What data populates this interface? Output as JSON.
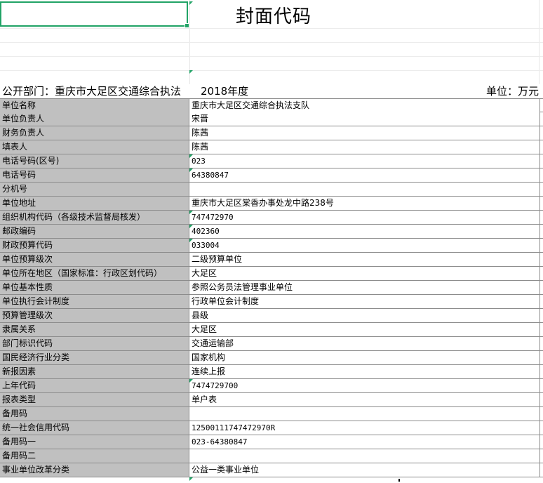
{
  "sheet": {
    "title": "封面代码",
    "department_line": "公开部门：重庆市大足区交通综合执法",
    "year": "2018年度",
    "unit": "单位：万元"
  },
  "rows": [
    {
      "label": "单位名称",
      "value": "重庆市大足区交通综合执法支队",
      "mono": false,
      "marked": false
    },
    {
      "label": "单位负责人",
      "value": "宋晋",
      "mono": false,
      "marked": false
    },
    {
      "label": "财务负责人",
      "value": "陈茜",
      "mono": false,
      "marked": false
    },
    {
      "label": "填表人",
      "value": "陈茜",
      "mono": false,
      "marked": false
    },
    {
      "label": "电话号码(区号)",
      "value": "023",
      "mono": true,
      "marked": true
    },
    {
      "label": "电话号码",
      "value": "64380847",
      "mono": true,
      "marked": true
    },
    {
      "label": "分机号",
      "value": "",
      "mono": false,
      "marked": false
    },
    {
      "label": "单位地址",
      "value": "重庆市大足区棠香办事处龙中路238号",
      "mono": false,
      "marked": false
    },
    {
      "label": "组织机构代码（各级技术监督局核发）",
      "value": "747472970",
      "mono": true,
      "marked": true
    },
    {
      "label": "邮政编码",
      "value": "402360",
      "mono": true,
      "marked": true
    },
    {
      "label": "财政预算代码",
      "value": "033004",
      "mono": true,
      "marked": true
    },
    {
      "label": "单位预算级次",
      "value": "二级预算单位",
      "mono": false,
      "marked": false
    },
    {
      "label": "单位所在地区（国家标准：行政区划代码）",
      "value": "大足区",
      "mono": false,
      "marked": false
    },
    {
      "label": "单位基本性质",
      "value": "参照公务员法管理事业单位",
      "mono": false,
      "marked": false
    },
    {
      "label": "单位执行会计制度",
      "value": "行政单位会计制度",
      "mono": false,
      "marked": false
    },
    {
      "label": "预算管理级次",
      "value": "县级",
      "mono": false,
      "marked": false
    },
    {
      "label": "隶属关系",
      "value": "大足区",
      "mono": false,
      "marked": false
    },
    {
      "label": "部门标识代码",
      "value": "交通运输部",
      "mono": false,
      "marked": false
    },
    {
      "label": "国民经济行业分类",
      "value": "国家机构",
      "mono": false,
      "marked": false
    },
    {
      "label": "新报因素",
      "value": "连续上报",
      "mono": false,
      "marked": false
    },
    {
      "label": "上年代码",
      "value": "7474729700",
      "mono": true,
      "marked": true
    },
    {
      "label": "报表类型",
      "value": "单户表",
      "mono": false,
      "marked": false
    },
    {
      "label": "备用码",
      "value": "",
      "mono": false,
      "marked": false
    },
    {
      "label": "统一社会信用代码",
      "value": "12500111747472970R",
      "mono": true,
      "marked": false
    },
    {
      "label": "备用码一",
      "value": "023-64380847",
      "mono": true,
      "marked": false
    },
    {
      "label": "备用码二",
      "value": "",
      "mono": false,
      "marked": false
    },
    {
      "label": "事业单位改革分类",
      "value": "公益一类事业单位",
      "mono": false,
      "marked": false
    }
  ],
  "colors": {
    "label_bg": "#c0c0c0",
    "grid_line": "#8c8c8c",
    "selection": "#21a366"
  }
}
